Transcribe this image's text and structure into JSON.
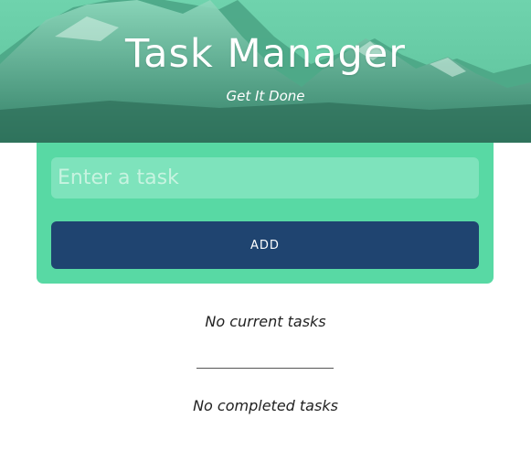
{
  "header": {
    "title": "Task Manager",
    "subtitle": "Get It Done"
  },
  "form": {
    "input_placeholder": "Enter a task",
    "input_value": "",
    "add_label": "ADD"
  },
  "lists": {
    "current_empty": "No current tasks",
    "completed_empty": "No completed tasks"
  },
  "colors": {
    "accent": "#58d9a4",
    "input_bg": "#7ee3bc",
    "button": "#1f4470"
  }
}
